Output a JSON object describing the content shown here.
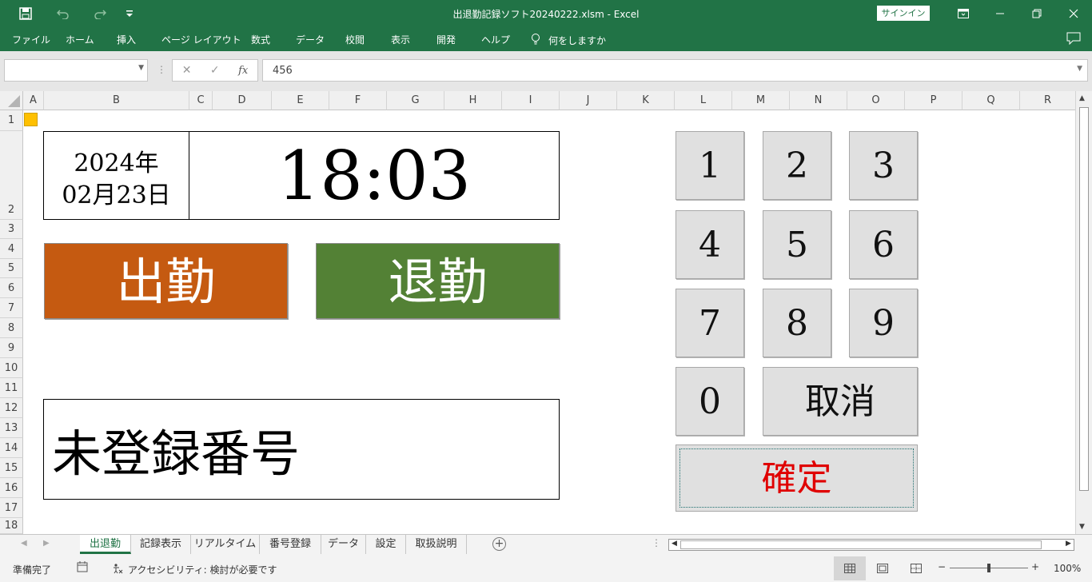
{
  "titlebar": {
    "title": "出退勤記録ソフト20240222.xlsm  -  Excel",
    "signin": "サインイン",
    "qat_icons": [
      "save-icon",
      "undo-icon",
      "redo-icon",
      "customize-qat-icon"
    ],
    "window_icons": [
      "ribbon-display-icon",
      "minimize-icon",
      "restore-icon",
      "close-icon"
    ]
  },
  "ribbon": {
    "tabs": [
      "ファイル",
      "ホーム",
      "挿入",
      "ページ レイアウト",
      "数式",
      "データ",
      "校閲",
      "表示",
      "開発",
      "ヘルプ"
    ],
    "tell_me": "何をしますか"
  },
  "formula_bar": {
    "name_box": "",
    "formula": "456"
  },
  "grid": {
    "columns": [
      "A",
      "B",
      "C",
      "D",
      "E",
      "F",
      "G",
      "H",
      "I",
      "J",
      "K",
      "L",
      "M",
      "N",
      "O",
      "P",
      "Q",
      "R"
    ],
    "rows": [
      "1",
      "2",
      "3",
      "4",
      "5",
      "6",
      "7",
      "8",
      "9",
      "10",
      "11",
      "12",
      "13",
      "14",
      "15",
      "16",
      "17",
      "18"
    ]
  },
  "clock": {
    "year": "2024年",
    "month_day": "02月23日",
    "time": "18:03"
  },
  "buttons": {
    "clock_in": "出勤",
    "clock_out": "退勤",
    "clock_in_color": "#c55a11",
    "clock_out_color": "#538135"
  },
  "status_message": "未登録番号",
  "keypad": {
    "keys": [
      "1",
      "2",
      "3",
      "4",
      "5",
      "6",
      "7",
      "8",
      "9",
      "0"
    ],
    "cancel": "取消",
    "confirm": "確定",
    "confirm_color": "#e00000"
  },
  "sheet_tabs": [
    "出退勤",
    "記録表示",
    "リアルタイム",
    "番号登録",
    "データ",
    "設定",
    "取扱説明"
  ],
  "active_sheet": "出退勤",
  "statusbar": {
    "ready": "準備完了",
    "accessibility": "アクセシビリティ: 検討が必要です",
    "zoom": "100%"
  },
  "theme": {
    "excel_green": "#217346"
  }
}
